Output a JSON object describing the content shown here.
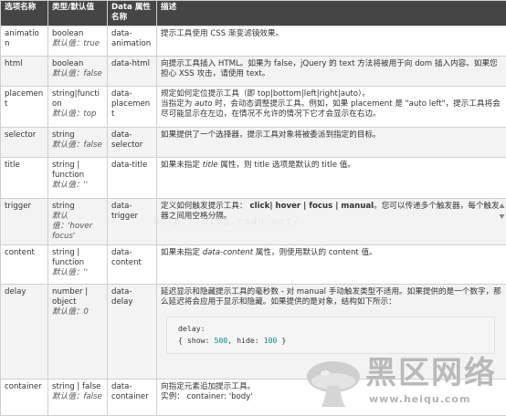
{
  "table": {
    "headers": [
      "选项名称",
      "类型/默认值",
      "Data 属性名称",
      "描述"
    ],
    "rows": [
      {
        "name": "animation",
        "type": "boolean",
        "default": "默认值：true",
        "attr": "data-animation",
        "desc": "提示工具使用 CSS 渐变滤镜效果。"
      },
      {
        "name": "html",
        "type": "boolean",
        "default": "默认值：false",
        "attr": "data-html",
        "desc": "向提示工具插入 HTML。如果为 false，jQuery 的 text 方法将被用于向 dom 插入内容。如果您担心 XSS 攻击，请使用 text。"
      },
      {
        "name": "placement",
        "type": "string|function",
        "default": "默认值：top",
        "attr": "data-placement",
        "desc_a": "规定如何定位提示工具（即 top|bottom|left|right|auto）。",
        "desc_b1": "当指定为 ",
        "desc_b_em": "auto",
        "desc_b2": " 时，会动态调整提示工具。例如，如果 placement 是 \"auto left\"，提示工具将会尽可能显示在左边，在情况不允许的情况下它才会显示在右边。"
      },
      {
        "name": "selector",
        "type": "string",
        "default": "默认值：false",
        "attr": "data-selector",
        "desc": "如果提供了一个选择器，提示工具对象将被委派到指定的目标。"
      },
      {
        "name": "title",
        "type": "string | function",
        "default": "默认值：''",
        "attr": "data-title",
        "desc_1": "如果未指定 ",
        "desc_em": "title",
        "desc_2": " 属性，则 title 选项是默认的 title 值。"
      },
      {
        "name": "trigger",
        "type": "string",
        "default": "默认值：'hover focus'",
        "attr": "data-trigger",
        "desc_1": "定义如何触发提示工具：",
        "desc_strong": " click| hover | focus | manual",
        "desc_2": "。您可以传递多个触发器，每个触发器之间用空格分隔。"
      },
      {
        "name": "content",
        "type": "string | function",
        "default": "默认值：''",
        "attr": "data-content",
        "desc_1": "如果未指定 ",
        "desc_em": "data-content",
        "desc_2": " 属性，则使用默认的 content 值。"
      },
      {
        "name": "delay",
        "type": "number | object",
        "default": "默认值：0",
        "attr": "data-delay",
        "desc": "延迟显示和隐藏提示工具的毫秒数 - 对 manual 手动触发类型不适用。如果提供的是一个数字，那么延迟将会应用于显示和隐藏。如果提供的是对象，结构如下所示：",
        "code_line1": "delay:",
        "code_show_key": "{ show: ",
        "code_show": "500",
        "code_hide_key": ", hide: ",
        "code_hide": "100",
        "code_end": " }"
      },
      {
        "name": "container",
        "type": "string | false",
        "default": "默认值：false",
        "attr": "data-container",
        "desc": "向指定元素追加提示工具。",
        "desc_example": "实例： container: 'body'"
      }
    ]
  },
  "watermark": "http://blog.csdn.net/",
  "logo": {
    "name": "黑区网络",
    "url": "www.heiqu.com",
    "accent": "#b9b9b9"
  }
}
